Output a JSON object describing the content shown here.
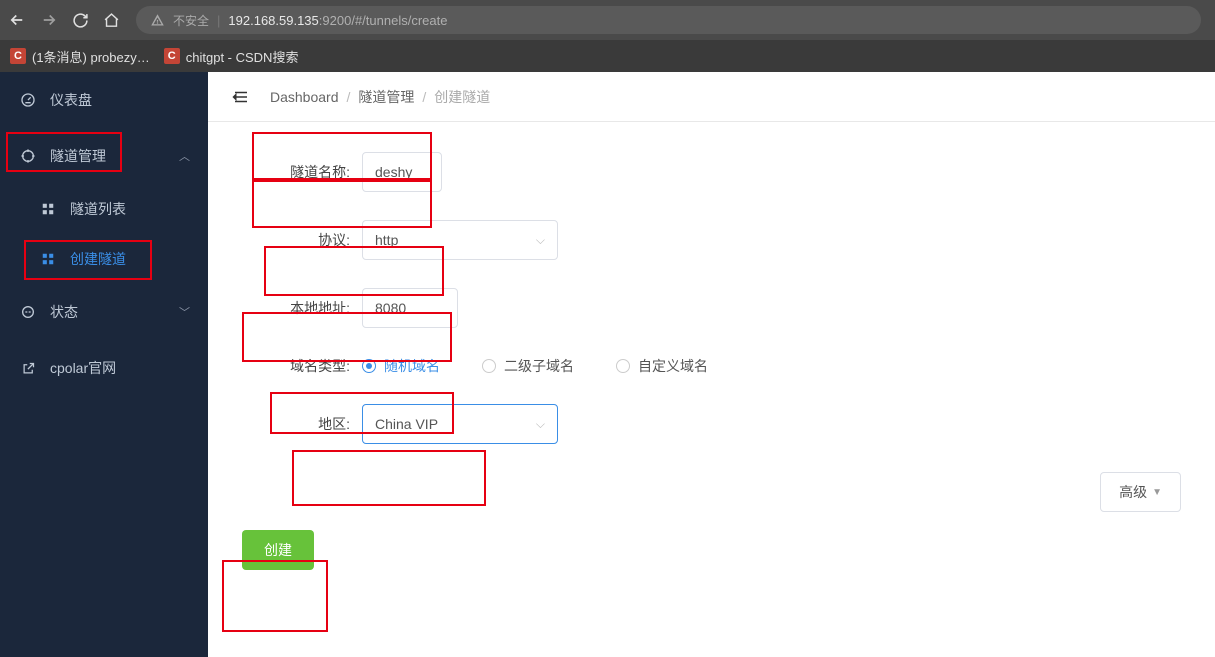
{
  "browser": {
    "secure_label": "不安全",
    "url_host": "192.168.59.135",
    "url_port": ":9200",
    "url_path": "/#/tunnels/create"
  },
  "bookmarks": [
    {
      "icon": "C",
      "label": "(1条消息) probezy…"
    },
    {
      "icon": "C",
      "label": "chitgpt - CSDN搜索"
    }
  ],
  "sidebar": {
    "dashboard": "仪表盘",
    "tunnels": "隧道管理",
    "tunnel_list": "隧道列表",
    "tunnel_create": "创建隧道",
    "status": "状态",
    "official": "cpolar官网"
  },
  "breadcrumb": {
    "a": "Dashboard",
    "b": "隧道管理",
    "c": "创建隧道"
  },
  "form": {
    "name_label": "隧道名称:",
    "name_value": "deshy",
    "protocol_label": "协议:",
    "protocol_value": "http",
    "local_label": "本地地址:",
    "local_value": "8080",
    "domain_type_label": "域名类型:",
    "domain_type_options": {
      "random": "随机域名",
      "sub": "二级子域名",
      "custom": "自定义域名"
    },
    "region_label": "地区:",
    "region_value": "China VIP",
    "advanced_label": "高级",
    "create_label": "创建"
  }
}
